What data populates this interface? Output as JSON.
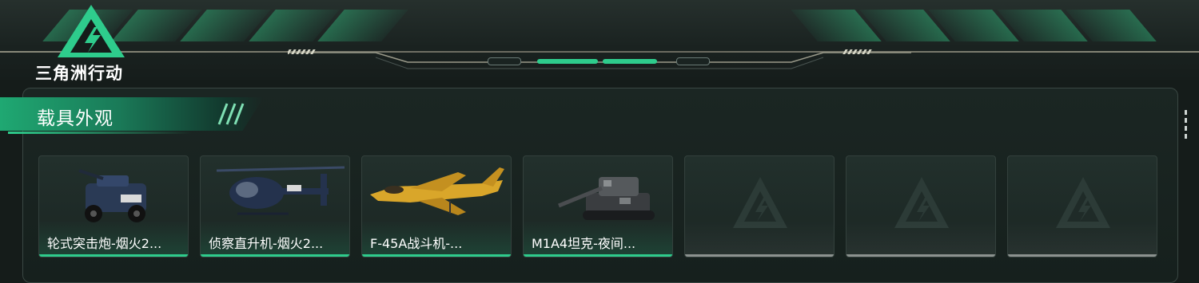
{
  "game": {
    "title": "三角洲行动"
  },
  "section": {
    "title": "载具外观"
  },
  "vehicles": [
    {
      "name": "轮式突击炮-烟火2...",
      "icon": "armored-car-icon",
      "equipped": true
    },
    {
      "name": "侦察直升机-烟火2...",
      "icon": "helicopter-icon",
      "equipped": true
    },
    {
      "name": "F-45A战斗机-...",
      "icon": "fighter-jet-icon",
      "equipped": true
    },
    {
      "name": "M1A4坦克-夜间...",
      "icon": "tank-icon",
      "equipped": true
    },
    {
      "name": "",
      "icon": "placeholder-logo-icon",
      "equipped": false
    },
    {
      "name": "",
      "icon": "placeholder-logo-icon",
      "equipped": false
    },
    {
      "name": "",
      "icon": "placeholder-logo-icon",
      "equipped": false
    }
  ],
  "colors": {
    "accent": "#2ecc8c",
    "panel": "#1b2623",
    "empty_accent": "#8c928f"
  }
}
